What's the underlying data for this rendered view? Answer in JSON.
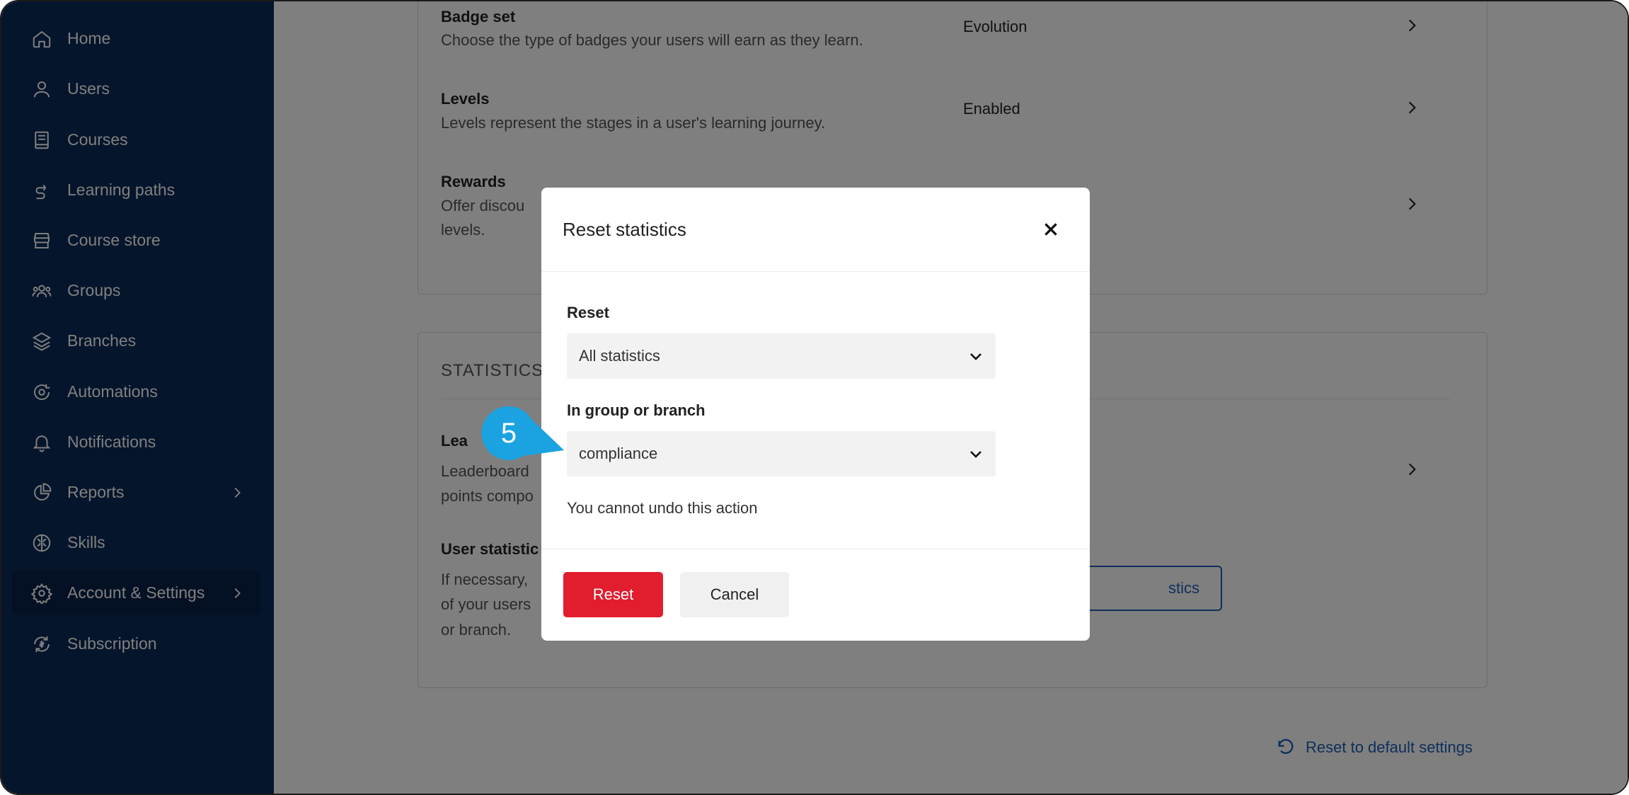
{
  "sidebar": {
    "items": [
      {
        "label": "Home",
        "icon": "home-icon"
      },
      {
        "label": "Users",
        "icon": "user-icon"
      },
      {
        "label": "Courses",
        "icon": "book-icon"
      },
      {
        "label": "Learning paths",
        "icon": "path-icon"
      },
      {
        "label": "Course store",
        "icon": "store-icon"
      },
      {
        "label": "Groups",
        "icon": "groups-icon"
      },
      {
        "label": "Branches",
        "icon": "layers-icon"
      },
      {
        "label": "Automations",
        "icon": "automation-icon"
      },
      {
        "label": "Notifications",
        "icon": "bell-icon"
      },
      {
        "label": "Reports",
        "icon": "pie-chart-icon"
      },
      {
        "label": "Skills",
        "icon": "brain-icon"
      },
      {
        "label": "Account & Settings",
        "icon": "gear-icon"
      },
      {
        "label": "Subscription",
        "icon": "subscription-icon"
      }
    ]
  },
  "gamification": {
    "badge_set": {
      "title": "Badge set",
      "desc": "Choose the type of badges your users will earn as they learn.",
      "value": "Evolution"
    },
    "levels": {
      "title": "Levels",
      "desc": "Levels represent the stages in a user's learning journey.",
      "value": "Enabled"
    },
    "rewards": {
      "title": "Rewards",
      "desc_line1": "Offer discou",
      "desc_line2": "levels."
    }
  },
  "statistics": {
    "section_title": "STATISTICS",
    "leaderboard": {
      "title": "Lea",
      "desc_line1": "Leaderboard",
      "desc_line2": "points compo"
    },
    "user_stats": {
      "title": "User statistic",
      "desc_line1": "If necessary,",
      "desc_line2": "of your users",
      "desc_line3": "or branch.",
      "button_label": "stics"
    }
  },
  "footer": {
    "reset_default": "Reset to default settings"
  },
  "modal": {
    "title": "Reset statistics",
    "reset_label": "Reset",
    "reset_value": "All statistics",
    "group_label": "In group or branch",
    "group_value": "compliance",
    "warning": "You cannot undo this action",
    "confirm_label": "Reset",
    "cancel_label": "Cancel"
  },
  "callout": {
    "step": "5"
  },
  "colors": {
    "sidebar": "#0b2a57",
    "accent": "#1f5fb5",
    "danger": "#e11d2e",
    "callout": "#1aa3e0"
  }
}
